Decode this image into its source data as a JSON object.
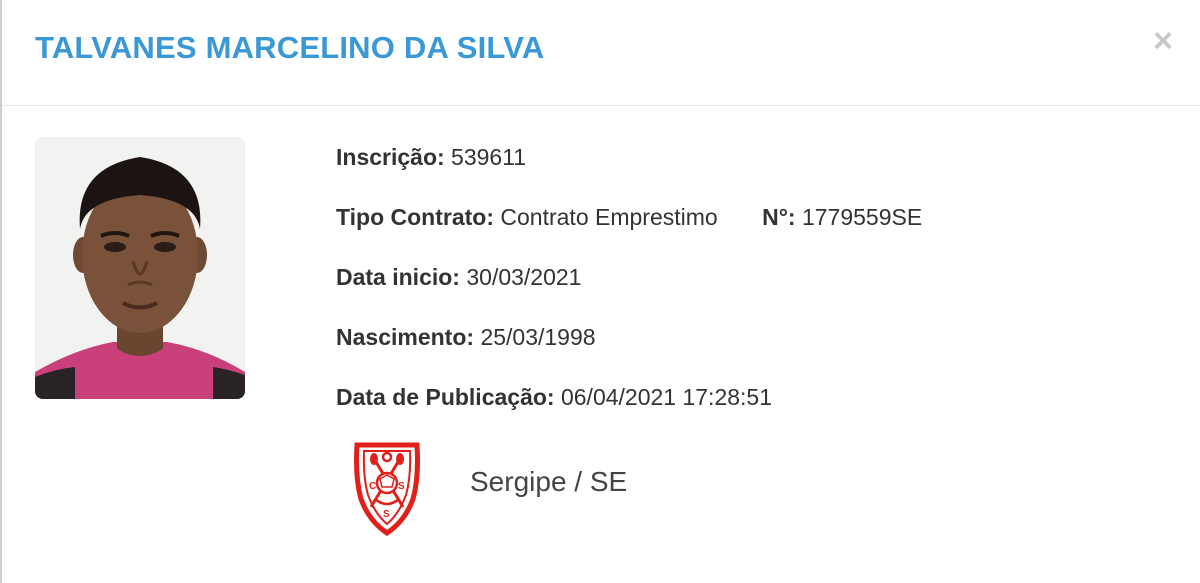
{
  "header": {
    "title": "TALVANES MARCELINO DA SILVA",
    "close_label": "×"
  },
  "player": {
    "photo_icon": "athlete-portrait",
    "fields": {
      "inscricao": {
        "label": "Inscrição:",
        "value": "539611"
      },
      "tipo_contrato": {
        "label": "Tipo Contrato:",
        "value": "Contrato Emprestimo"
      },
      "numero": {
        "label": "N°:",
        "value": "1779559SE"
      },
      "data_inicio": {
        "label": "Data inicio:",
        "value": "30/03/2021"
      },
      "nascimento": {
        "label": "Nascimento:",
        "value": "25/03/1998"
      },
      "data_publicacao": {
        "label": "Data de Publicação:",
        "value": "06/04/2021 17:28:51"
      }
    }
  },
  "club": {
    "name": "Sergipe / SE",
    "crest_icon": "club-crest-icon",
    "crest_color": "#e0201b"
  },
  "colors": {
    "title": "#3a98d6",
    "label_text": "#333333",
    "close": "#c8c8c8"
  }
}
